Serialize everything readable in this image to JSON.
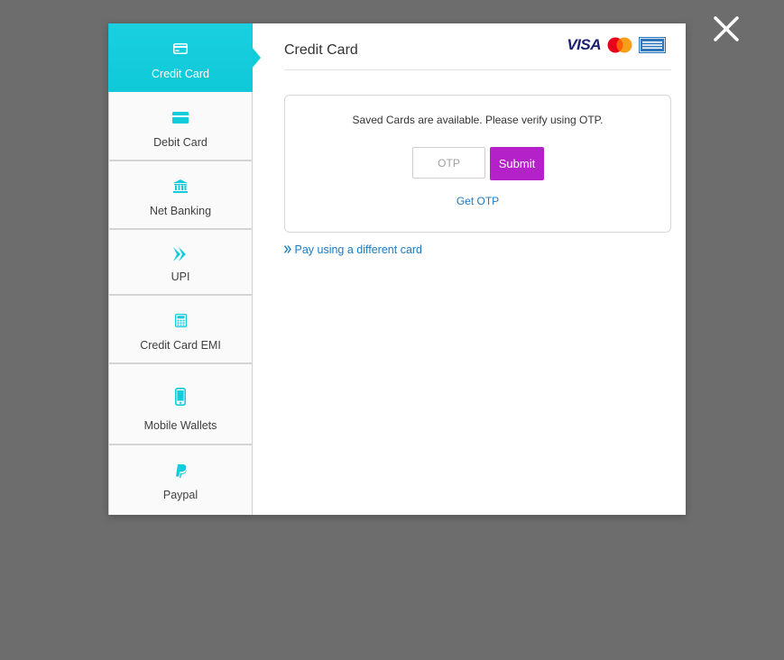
{
  "close_label": "×",
  "sidebar": {
    "items": [
      {
        "label": "Credit Card",
        "icon": "credit-card-icon",
        "active": true
      },
      {
        "label": "Debit Card",
        "icon": "debit-card-icon",
        "active": false
      },
      {
        "label": "Net Banking",
        "icon": "bank-icon",
        "active": false
      },
      {
        "label": "UPI",
        "icon": "upi-icon",
        "active": false
      },
      {
        "label": "Credit Card EMI",
        "icon": "calculator-icon",
        "active": false
      },
      {
        "label": "Mobile Wallets",
        "icon": "mobile-icon",
        "active": false
      },
      {
        "label": "Paypal",
        "icon": "paypal-icon",
        "active": false
      }
    ]
  },
  "content": {
    "title": "Credit Card",
    "brands": {
      "visa": "VISA",
      "mastercard": "mastercard-logo",
      "amex": "amex-logo"
    },
    "otp": {
      "message": "Saved Cards are available. Please verify using OTP.",
      "placeholder": "OTP",
      "submit_label": "Submit",
      "get_otp_label": "Get OTP"
    },
    "different_card_label": "Pay using a different card"
  },
  "colors": {
    "accent": "#12cbdb",
    "submit": "#b521c8",
    "link": "#1b7bc4",
    "overlay": "#6d6d6d"
  }
}
